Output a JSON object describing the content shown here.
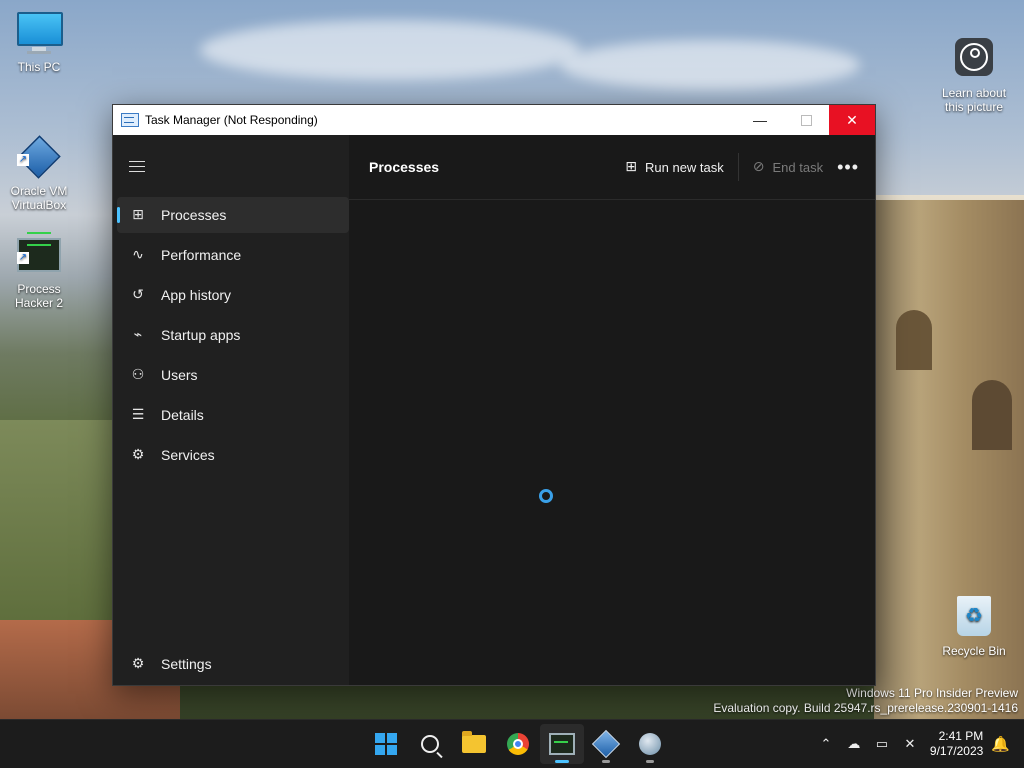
{
  "desktop": {
    "icons": [
      {
        "label": "This PC"
      },
      {
        "label": "Oracle VM\nVirtualBox"
      },
      {
        "label": "Process\nHacker 2"
      },
      {
        "label": "Learn about\nthis picture"
      },
      {
        "label": "Recycle Bin"
      }
    ],
    "watermark": {
      "line1": "Windows 11 Pro Insider Preview",
      "line2": "Evaluation copy. Build 25947.rs_prerelease.230901-1416"
    }
  },
  "window": {
    "title": "Task Manager (Not Responding)",
    "controls": {
      "minimize": "—",
      "close": "✕"
    }
  },
  "nav": {
    "items": [
      {
        "label": "Processes",
        "icon": "processes-icon",
        "active": true
      },
      {
        "label": "Performance",
        "icon": "performance-icon"
      },
      {
        "label": "App history",
        "icon": "history-icon"
      },
      {
        "label": "Startup apps",
        "icon": "startup-icon"
      },
      {
        "label": "Users",
        "icon": "users-icon"
      },
      {
        "label": "Details",
        "icon": "details-icon"
      },
      {
        "label": "Services",
        "icon": "services-icon"
      }
    ],
    "settings": "Settings"
  },
  "main": {
    "title": "Processes",
    "run_new_task": "Run new task",
    "end_task": "End task",
    "more": "•••"
  },
  "taskbar": {
    "apps": [
      "start-button",
      "search",
      "file-explorer",
      "chrome",
      "task-manager",
      "virtualbox",
      "globe-app"
    ],
    "clock": {
      "time": "2:41 PM",
      "date": "9/17/2023"
    }
  },
  "colors": {
    "accent": "#4cc2ff",
    "close_red": "#e81123",
    "nav_bg": "#202020",
    "main_bg": "#191919"
  }
}
